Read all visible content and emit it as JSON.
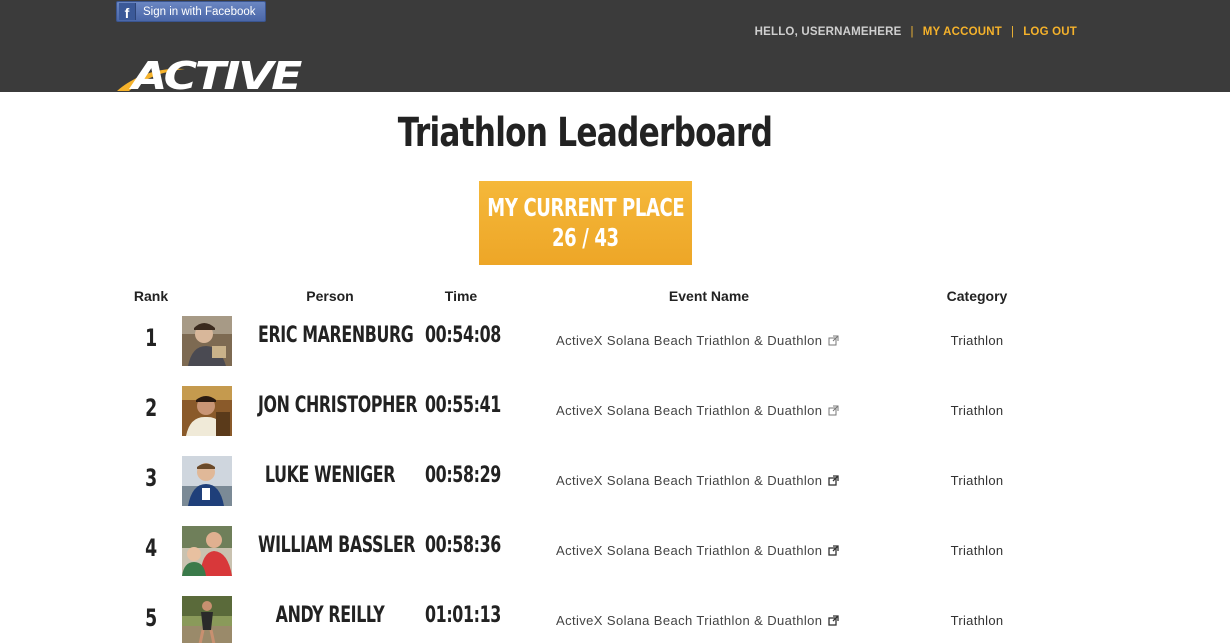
{
  "header": {
    "facebook_label": "Sign in with Facebook",
    "greeting": "HELLO, USERNAMEHERE",
    "my_account": "MY ACCOUNT",
    "log_out": "LOG OUT",
    "separator": "|",
    "logo_text": "ACTIVE",
    "accent_color": "#f5b22b"
  },
  "title": "Triathlon Leaderboard",
  "current_place": {
    "label": "MY CURRENT PLACE",
    "value": "26 / 43"
  },
  "table": {
    "columns": {
      "rank": "Rank",
      "person": "Person",
      "time": "Time",
      "event": "Event Name",
      "category": "Category"
    },
    "rows": [
      {
        "rank": "1",
        "name": "ERIC MARENBURG",
        "time": "00:54:08",
        "event": "ActiveX Solana Beach Triathlon & Duathlon",
        "category": "Triathlon"
      },
      {
        "rank": "2",
        "name": "JON CHRISTOPHER",
        "time": "00:55:41",
        "event": "ActiveX Solana Beach Triathlon & Duathlon",
        "category": "Triathlon"
      },
      {
        "rank": "3",
        "name": "LUKE WENIGER",
        "time": "00:58:29",
        "event": "ActiveX Solana Beach Triathlon & Duathlon",
        "category": "Triathlon"
      },
      {
        "rank": "4",
        "name": "WILLIAM BASSLER",
        "time": "00:58:36",
        "event": "ActiveX Solana Beach Triathlon & Duathlon",
        "category": "Triathlon"
      },
      {
        "rank": "5",
        "name": "ANDY REILLY",
        "time": "01:01:13",
        "event": "ActiveX Solana Beach Triathlon & Duathlon",
        "category": "Triathlon"
      }
    ]
  }
}
